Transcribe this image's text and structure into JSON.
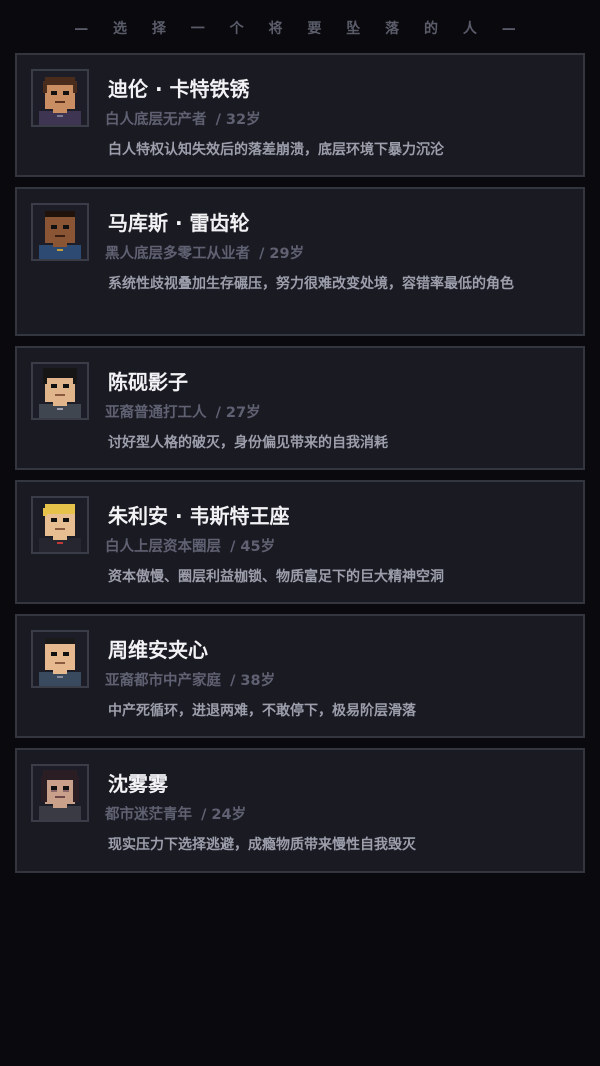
{
  "header": {
    "title": "— 选 择 一 个 将 要 坠 落 的 人 —"
  },
  "characters": [
    {
      "name": "迪伦 · 卡特铁锈",
      "identity": "白人底层无产者",
      "age": "/ 32岁",
      "desc": "白人特权认知失效后的落差崩溃，底层环境下暴力沉沦",
      "portrait": {
        "skin": "#c98e62",
        "hair": "#4a2c1c",
        "shirt": "#3d3552"
      }
    },
    {
      "name": "马库斯 · 雷齿轮",
      "identity": "黑人底层多零工从业者",
      "age": "/ 29岁",
      "desc": "系统性歧视叠加生存碾压，努力很难改变处境，容错率最低的角色",
      "portrait": {
        "skin": "#8a5535",
        "hair": "#1e120b",
        "shirt": "#2d4a72"
      }
    },
    {
      "name": "陈砚影子",
      "identity": "亚裔普通打工人",
      "age": "/ 27岁",
      "desc": "讨好型人格的破灭，身份偏见带来的自我消耗",
      "portrait": {
        "skin": "#e1b58c",
        "hair": "#161616",
        "shirt": "#3f4650"
      }
    },
    {
      "name": "朱利安 · 韦斯特王座",
      "identity": "白人上层资本圈层",
      "age": "/ 45岁",
      "desc": "资本傲慢、圈层利益枷锁、物质富足下的巨大精神空洞",
      "portrait": {
        "skin": "#e7bd92",
        "hair": "#e6c24a",
        "shirt": "#262630"
      }
    },
    {
      "name": "周维安夹心",
      "identity": "亚裔都市中产家庭",
      "age": "/ 38岁",
      "desc": "中产死循环，进退两难，不敢停下，极易阶层滑落",
      "portrait": {
        "skin": "#e6b98e",
        "hair": "#1a1a1a",
        "shirt": "#3a4a5e"
      }
    },
    {
      "name": "沈雾雾",
      "identity": "都市迷茫青年",
      "age": "/ 24岁",
      "desc": "现实压力下选择逃避，成瘾物质带来慢性自我毁灭",
      "portrait": {
        "skin": "#c9a08a",
        "hair": "#2a1e24",
        "shirt": "#3a3a44"
      }
    }
  ]
}
